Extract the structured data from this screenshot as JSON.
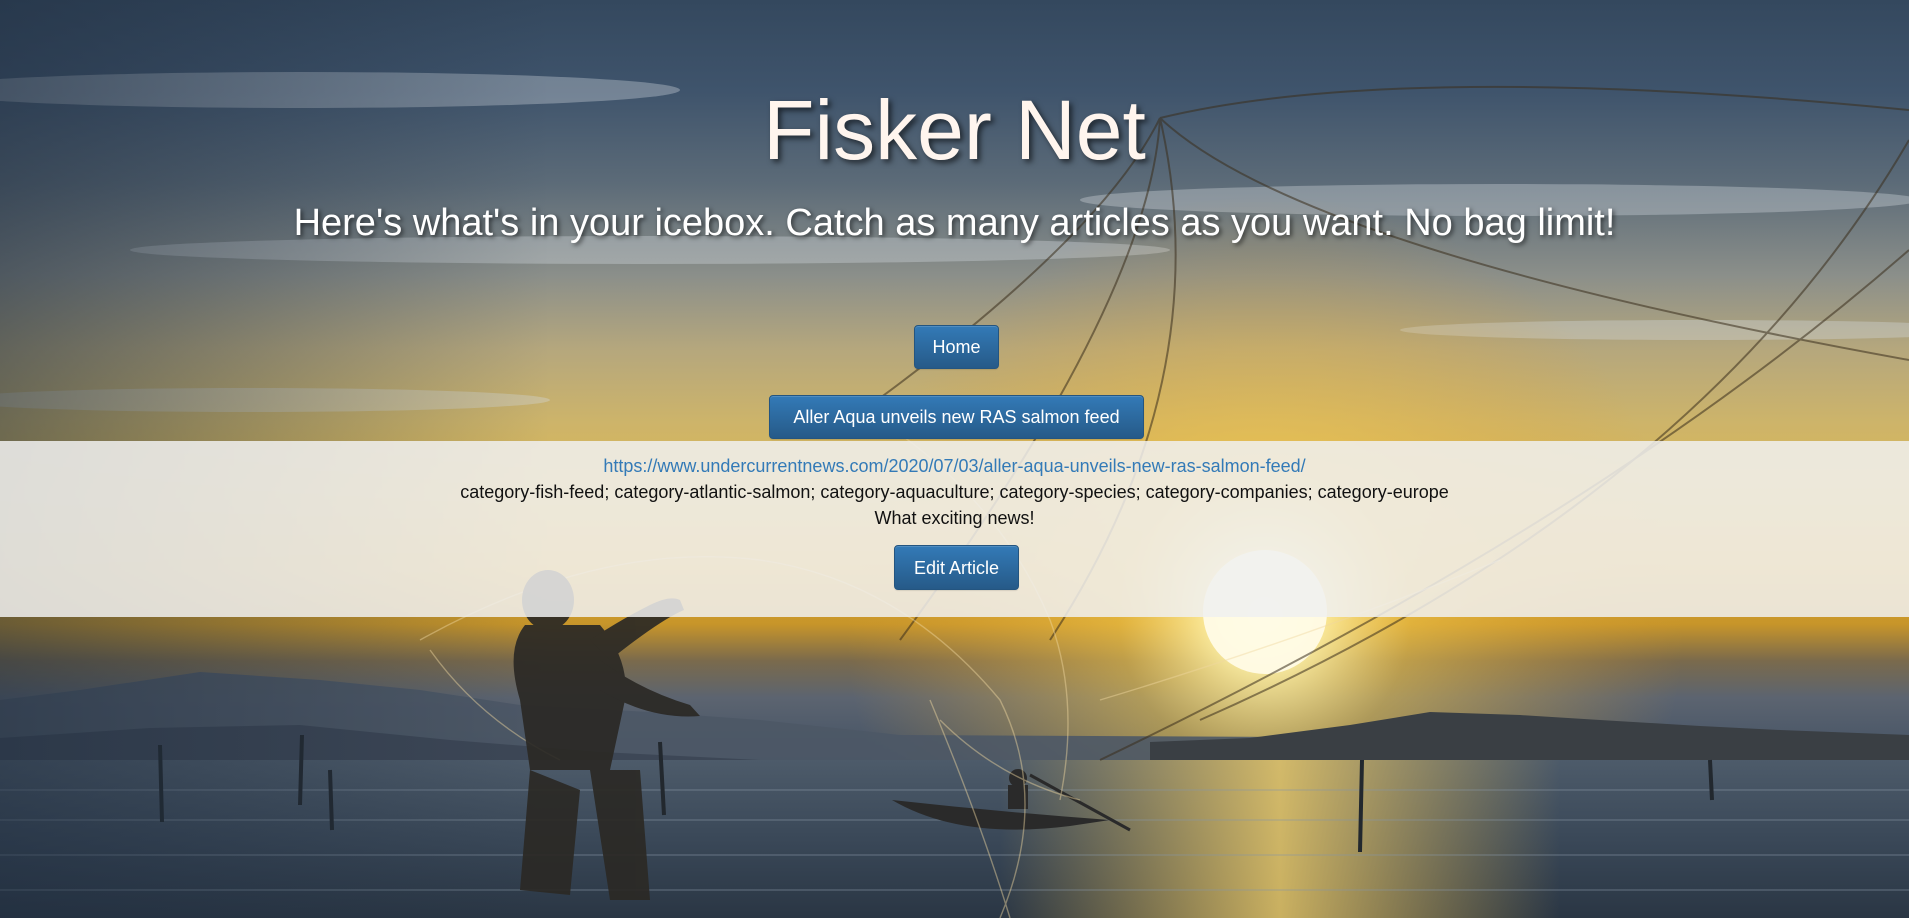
{
  "header": {
    "title": "Fisker Net",
    "subtitle": "Here's what's in your icebox. Catch as many articles as you want. No bag limit!"
  },
  "nav": {
    "home_label": "Home"
  },
  "article": {
    "title": "Aller Aqua unveils new RAS salmon feed",
    "url": "https://www.undercurrentnews.com/2020/07/03/aller-aqua-unveils-new-ras-salmon-feed/",
    "categories": "category-fish-feed; category-atlantic-salmon; category-aquaculture; category-species; category-companies; category-europe",
    "comment": "What exciting news!",
    "edit_label": "Edit Article"
  },
  "colors": {
    "button_blue": "#337ab7",
    "link_blue": "#337ab7",
    "panel_overlay": "#f0f0f0"
  },
  "background": {
    "description_icon": "fisherman-casting-net-sunset-photo"
  }
}
